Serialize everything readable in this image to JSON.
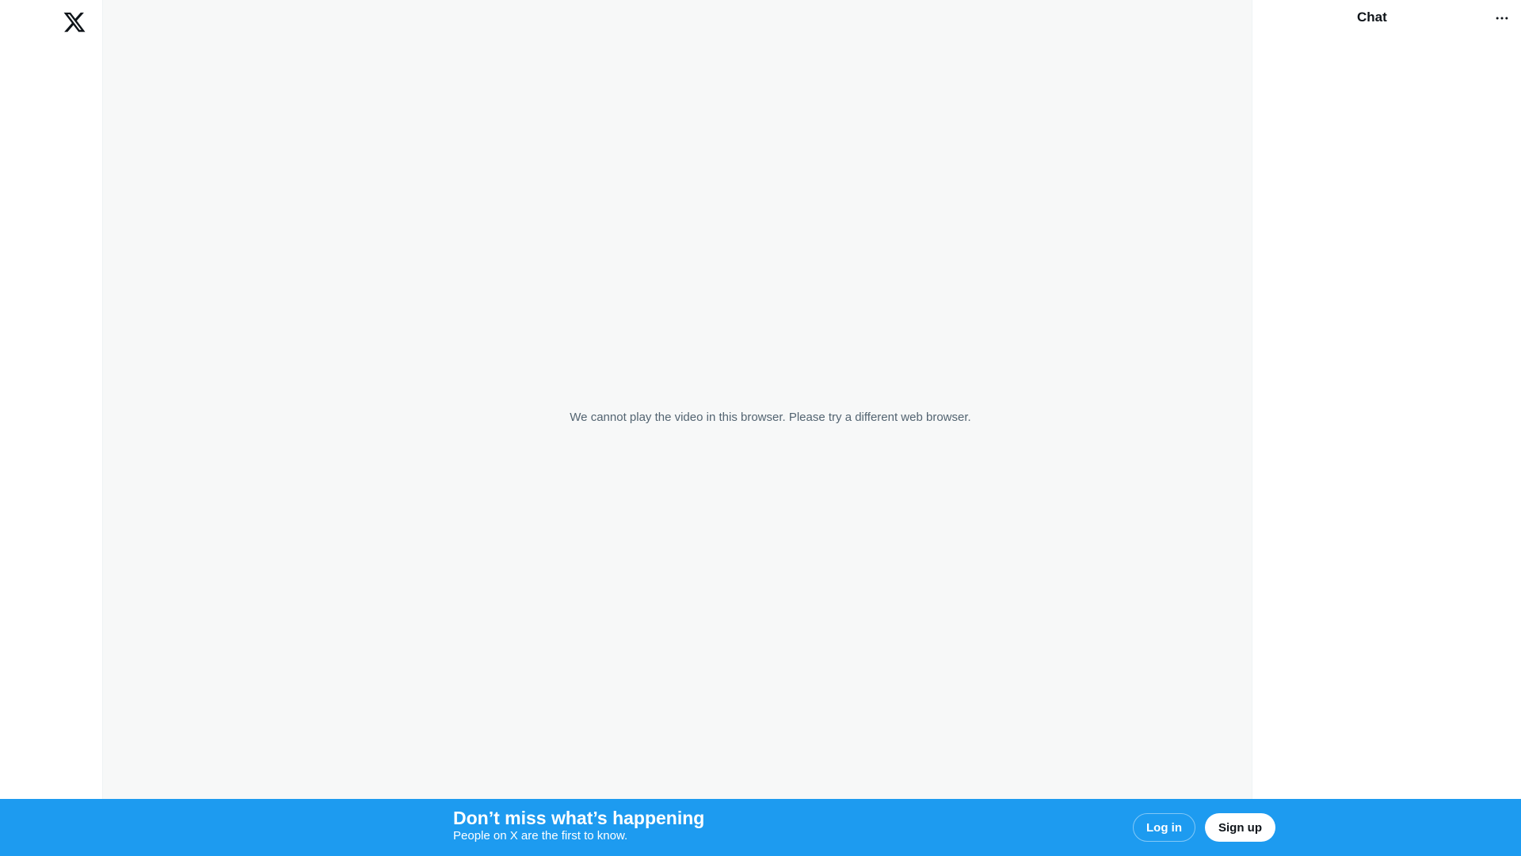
{
  "logo": {
    "icon": "x-logo-icon"
  },
  "media": {
    "message": "We cannot play the video in this browser. Please try a different web browser.",
    "background": "#f7f8f8"
  },
  "chat": {
    "title": "Chat",
    "more_icon": "more-horizontal-icon"
  },
  "banner": {
    "heading": "Don’t miss what’s happening",
    "subheading": "People on X are the first to know.",
    "login_label": "Log in",
    "signup_label": "Sign up",
    "background": "#1d9bf0"
  }
}
